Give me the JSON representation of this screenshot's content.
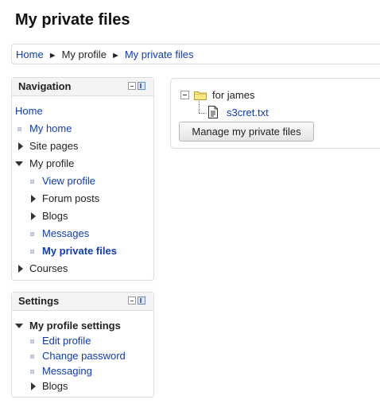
{
  "page": {
    "title": "My private files"
  },
  "breadcrumb": {
    "separator": "►",
    "items": [
      "Home",
      "My profile",
      "My private files"
    ]
  },
  "navigation": {
    "title": "Navigation",
    "items": [
      {
        "label": "Home",
        "type": "link"
      },
      {
        "label": "My home",
        "type": "link"
      },
      {
        "label": "Site pages",
        "type": "collapsed"
      },
      {
        "label": "My profile",
        "type": "expanded"
      },
      {
        "label": "View profile",
        "type": "link"
      },
      {
        "label": "Forum posts",
        "type": "collapsed"
      },
      {
        "label": "Blogs",
        "type": "collapsed"
      },
      {
        "label": "Messages",
        "type": "link"
      },
      {
        "label": "My private files",
        "type": "current"
      },
      {
        "label": "Courses",
        "type": "collapsed"
      }
    ]
  },
  "settings": {
    "title": "Settings",
    "items": [
      {
        "label": "My profile settings",
        "type": "expanded"
      },
      {
        "label": "Edit profile",
        "type": "link"
      },
      {
        "label": "Change password",
        "type": "link"
      },
      {
        "label": "Messaging",
        "type": "link"
      },
      {
        "label": "Blogs",
        "type": "collapsed"
      }
    ]
  },
  "files": {
    "folder": "for james",
    "file": "s3cret.txt",
    "manage_button": "Manage my private files"
  },
  "icons": {
    "collapse": "minus-box-icon",
    "folder": "folder-icon",
    "file": "text-file-icon",
    "block_minimize": "minimize-icon",
    "block_dock": "dock-icon"
  },
  "colors": {
    "link": "#0f3bb9",
    "border": "#dddddd",
    "header_bg": "#f4f4f4"
  }
}
